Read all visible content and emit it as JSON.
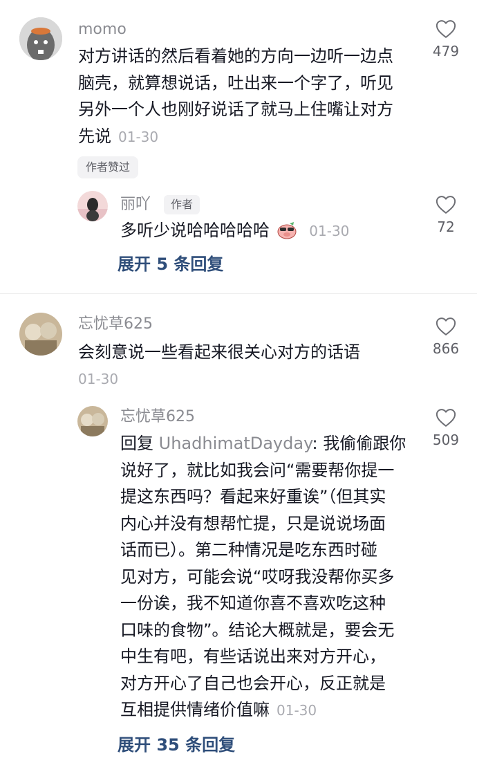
{
  "comments": [
    {
      "username": "momo",
      "lines": [
        "对方讲话的然后看着她的方向一边听一边点",
        "脑壳，就算想说话，吐出来一个字了，听见",
        "另外一个人也刚好说话了就马上住嘴让对方",
        "先说"
      ],
      "date": "01-30",
      "likes": "479",
      "badge": "作者赞过",
      "replies": [
        {
          "username": "丽吖",
          "author_tag": "作者",
          "text": "多听少说哈哈哈哈哈",
          "date": "01-30",
          "likes": "72"
        }
      ],
      "expand_label": "展开 5 条回复"
    },
    {
      "username": "忘忧草625",
      "lines": [
        "会刻意说一些看起来很关心对方的话语"
      ],
      "date": "01-30",
      "likes": "866",
      "replies": [
        {
          "username": "忘忧草625",
          "reply_prefix": "回复",
          "mention": "UhadhimatDayday",
          "first_line_rest": ": 我偷偷跟你",
          "lines": [
            "说好了，就比如我会问“需要帮你提一",
            "提这东西吗？看起来好重诶”（但其实",
            "内心并没有想帮忙提，只是说说场面",
            "话而已）。第二种情况是吃东西时碰",
            "见对方，可能会说“哎呀我没帮你买多",
            "一份诶，我不知道你喜不喜欢吃这种",
            "口味的食物”。结论大概就是，要会无",
            "中生有吧，有些话说出来对方开心，",
            "对方开心了自己也会开心，反正就是",
            "互相提供情绪价值嘛"
          ],
          "date": "01-30",
          "likes": "509"
        }
      ],
      "expand_label": "展开 35 条回复"
    }
  ],
  "icons": {
    "like": "heart-outline-icon",
    "emoji": "pig-sunglasses-emoji"
  },
  "colors": {
    "text": "#161823",
    "meta": "#8a8b91",
    "expand": "#2f4e7a"
  }
}
